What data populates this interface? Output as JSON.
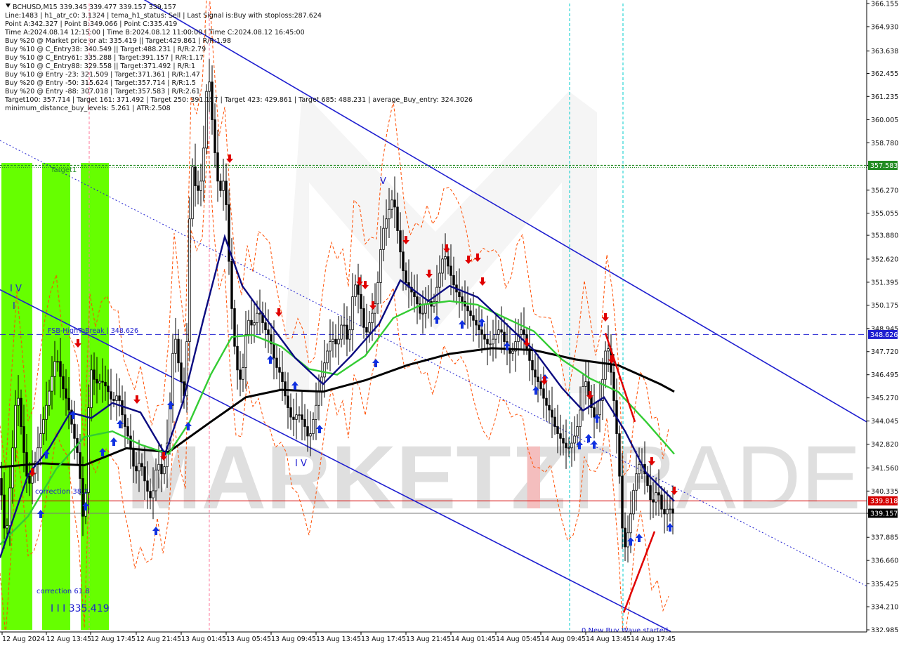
{
  "colors": {
    "background": "#ffffff",
    "green_band": "#66ff00",
    "channel_blue": "#1f1fd0",
    "candle": "#000000",
    "ma_black": "#000000",
    "ma_green": "#33cc33",
    "ma_navy": "#0a0a80",
    "envelope_orange": "#ff4d00",
    "target_line": "#228b22",
    "current_line": "#d40000",
    "bid_line": "#7a7a7a",
    "vline_cyan": "#00cccc",
    "vline_pink": "#ff7799",
    "arrow_up": "#1030e0",
    "arrow_down": "#e00000",
    "watermark": "#9a9a9a",
    "watermark_red": "#dd3333"
  },
  "info_lines": [
    "BCHUSD,M15  339.345 339.477 339.157 339.157",
    "Line:1483 | h1_atr_c0: 3.1324 | tema_h1_status: Sell | Last Signal is:Buy with stoploss:287.624",
    "Point A:342.327 | Point B:349.066 | Point C:335.419",
    "Time A:2024.08.14 12:15:00 | Time B:2024.08.12 11:00:00 | Time C:2024.08.12 16:45:00",
    "Buy %20 @ Market price or at: 335.419 || Target:429.861 | R/R:1.98",
    "Buy %10 @ C_Entry38: 340.549 || Target:488.231 | R/R:2.79",
    "Buy %10 @ C_Entry61: 335.288 | Target:391.157 | R/R:1.17",
    "Buy %10 @ C_Entry88: 329.558 || Target:371.492 | R/R:1",
    "Buy %10 @ Entry -23: 321.509 | Target:371.361 | R/R:1.47",
    "Buy %20 @ Entry -50: 315.624 | Target:357.714 | R/R:1.5",
    "Buy %20 @ Entry -88: 307.018 | Target:357.583 | R/R:2.61",
    "Target100: 357.714 | Target 161: 371.492 | Target 250: 391.157 | Target 423: 429.861 | Target 685: 488.231 | average_Buy_entry: 324.3026",
    "minimum_distance_buy_levels: 5.261 | ATR:2.508"
  ],
  "annotations": {
    "target": "Target1",
    "fsb": "FSB-HighToBreak | 348.626",
    "correction38": "correction 38.2",
    "correction61": "correction 61.8",
    "wave_iii": "I I I 335.419",
    "wave_iv": "I V",
    "wave_v": "V",
    "wave_top_left": "I V",
    "wave_top_left2": "I",
    "new_wave": "0 New Buy Wave started"
  },
  "price_tags": {
    "target": "357.583",
    "fsb": "348.626",
    "current": "339.818",
    "bid": "339.157"
  },
  "watermark": {
    "part1": "MARKETZ",
    "part2": "I",
    "part3": "TRADE"
  },
  "chart_data": {
    "type": "candlestick",
    "title": "BCHUSD,M15  339.345 339.477 339.157 339.157",
    "symbol": "BCHUSD",
    "timeframe": "M15",
    "ylim": [
      332.985,
      366.155
    ],
    "y_ticks": [
      "366.155",
      "364.930",
      "363.638",
      "362.455",
      "361.235",
      "360.005",
      "358.780",
      "357.583",
      "356.270",
      "355.055",
      "353.880",
      "352.620",
      "351.395",
      "350.175",
      "348.945",
      "347.720",
      "346.495",
      "345.270",
      "344.045",
      "342.820",
      "341.560",
      "340.335",
      "339.157",
      "337.885",
      "336.660",
      "335.425",
      "334.210",
      "332.985"
    ],
    "x_ticks": [
      "12 Aug 2024",
      "12 Aug 13:45",
      "12 Aug 17:45",
      "12 Aug 21:45",
      "13 Aug 01:45",
      "13 Aug 05:45",
      "13 Aug 09:45",
      "13 Aug 13:45",
      "13 Aug 17:45",
      "13 Aug 21:45",
      "14 Aug 01:45",
      "14 Aug 05:45",
      "14 Aug 09:45",
      "14 Aug 13:45",
      "14 Aug 17:45"
    ],
    "levels": {
      "target": 357.583,
      "fsb_high": 348.626,
      "current": 339.818,
      "bid": 339.157
    },
    "ohlc": {
      "open": 339.345,
      "high": 339.477,
      "low": 339.157,
      "close": 339.157
    },
    "close_path": [
      [
        0,
        341.0
      ],
      [
        8,
        337.5
      ],
      [
        16,
        341.5
      ],
      [
        24,
        346.0
      ],
      [
        32,
        343.0
      ],
      [
        40,
        340.5
      ],
      [
        48,
        341.5
      ],
      [
        56,
        343.0
      ],
      [
        64,
        344.5
      ],
      [
        72,
        346.0
      ],
      [
        80,
        347.6
      ],
      [
        88,
        346.0
      ],
      [
        96,
        345.0
      ],
      [
        104,
        343.5
      ],
      [
        112,
        342.0
      ],
      [
        120,
        338.0
      ],
      [
        128,
        347.0
      ],
      [
        136,
        346.0
      ],
      [
        144,
        346.2
      ],
      [
        152,
        345.8
      ],
      [
        160,
        345.0
      ],
      [
        168,
        345.5
      ],
      [
        176,
        344.0
      ],
      [
        184,
        343.0
      ],
      [
        192,
        341.2
      ],
      [
        200,
        342.0
      ],
      [
        208,
        340.5
      ],
      [
        216,
        339.8
      ],
      [
        224,
        342.0
      ],
      [
        232,
        341.0
      ],
      [
        240,
        343.5
      ],
      [
        248,
        349.0
      ],
      [
        256,
        346.5
      ],
      [
        264,
        345.0
      ],
      [
        272,
        358.0
      ],
      [
        280,
        356.0
      ],
      [
        288,
        357.0
      ],
      [
        296,
        363.0
      ],
      [
        304,
        359.0
      ],
      [
        312,
        356.0
      ],
      [
        320,
        357.0
      ],
      [
        328,
        351.0
      ],
      [
        336,
        347.0
      ],
      [
        344,
        346.0
      ],
      [
        352,
        349.5
      ],
      [
        360,
        349.0
      ],
      [
        368,
        350.0
      ],
      [
        376,
        349.0
      ],
      [
        384,
        348.5
      ],
      [
        392,
        347.0
      ],
      [
        400,
        346.5
      ],
      [
        408,
        345.0
      ],
      [
        416,
        344.0
      ],
      [
        424,
        344.5
      ],
      [
        432,
        344.0
      ],
      [
        440,
        343.0
      ],
      [
        448,
        344.5
      ],
      [
        456,
        346.0
      ],
      [
        464,
        347.5
      ],
      [
        472,
        348.5
      ],
      [
        480,
        348.0
      ],
      [
        488,
        349.5
      ],
      [
        496,
        348.0
      ],
      [
        504,
        351.5
      ],
      [
        512,
        350.5
      ],
      [
        520,
        348.5
      ],
      [
        528,
        349.5
      ],
      [
        536,
        350.5
      ],
      [
        544,
        354.0
      ],
      [
        552,
        355.0
      ],
      [
        560,
        356.0
      ],
      [
        568,
        353.5
      ],
      [
        576,
        351.5
      ],
      [
        584,
        351.0
      ],
      [
        592,
        350.5
      ],
      [
        600,
        349.5
      ],
      [
        608,
        350.5
      ],
      [
        616,
        350.0
      ],
      [
        624,
        351.5
      ],
      [
        632,
        353.0
      ],
      [
        640,
        352.0
      ],
      [
        648,
        351.0
      ],
      [
        656,
        350.5
      ],
      [
        664,
        350.0
      ],
      [
        672,
        349.5
      ],
      [
        680,
        349.0
      ],
      [
        688,
        348.5
      ],
      [
        696,
        348.0
      ],
      [
        704,
        348.5
      ],
      [
        712,
        349.0
      ],
      [
        720,
        348.0
      ],
      [
        728,
        347.5
      ],
      [
        736,
        348.5
      ],
      [
        744,
        349.0
      ],
      [
        752,
        347.5
      ],
      [
        760,
        346.5
      ],
      [
        768,
        346.0
      ],
      [
        776,
        345.0
      ],
      [
        784,
        344.5
      ],
      [
        792,
        343.5
      ],
      [
        800,
        343.0
      ],
      [
        808,
        342.5
      ],
      [
        816,
        343.0
      ],
      [
        824,
        344.0
      ],
      [
        832,
        346.5
      ],
      [
        840,
        345.0
      ],
      [
        848,
        344.0
      ],
      [
        856,
        345.5
      ],
      [
        864,
        348.5
      ],
      [
        872,
        346.0
      ],
      [
        880,
        342.5
      ],
      [
        888,
        337.0
      ],
      [
        896,
        338.5
      ],
      [
        904,
        341.0
      ],
      [
        912,
        342.0
      ],
      [
        920,
        341.0
      ],
      [
        928,
        339.5
      ],
      [
        936,
        340.5
      ],
      [
        944,
        339.0
      ],
      [
        952,
        339.5
      ],
      [
        958,
        339.157
      ]
    ],
    "series": [
      {
        "name": "",
        "color": "#000000",
        "points": [
          [
            0,
            341.6
          ],
          [
            60,
            341.8
          ],
          [
            120,
            341.7
          ],
          [
            180,
            342.6
          ],
          [
            240,
            342.4
          ],
          [
            300,
            344.0
          ],
          [
            350,
            345.3
          ],
          [
            400,
            345.7
          ],
          [
            460,
            345.6
          ],
          [
            520,
            346.2
          ],
          [
            580,
            347.0
          ],
          [
            640,
            347.6
          ],
          [
            700,
            347.9
          ],
          [
            760,
            347.8
          ],
          [
            820,
            347.3
          ],
          [
            880,
            347.0
          ],
          [
            940,
            346.0
          ],
          [
            960,
            345.6
          ]
        ]
      },
      {
        "name": "",
        "color": "#33cc33",
        "points": [
          [
            0,
            337.5
          ],
          [
            40,
            339.0
          ],
          [
            80,
            341.5
          ],
          [
            120,
            343.2
          ],
          [
            160,
            343.5
          ],
          [
            200,
            342.8
          ],
          [
            240,
            342.3
          ],
          [
            270,
            344.0
          ],
          [
            300,
            346.5
          ],
          [
            330,
            348.5
          ],
          [
            360,
            348.6
          ],
          [
            400,
            348.0
          ],
          [
            440,
            346.8
          ],
          [
            480,
            346.5
          ],
          [
            520,
            347.5
          ],
          [
            560,
            349.5
          ],
          [
            600,
            350.2
          ],
          [
            640,
            350.4
          ],
          [
            680,
            350.2
          ],
          [
            720,
            349.5
          ],
          [
            760,
            348.8
          ],
          [
            800,
            347.3
          ],
          [
            840,
            346.3
          ],
          [
            880,
            345.6
          ],
          [
            920,
            344.0
          ],
          [
            960,
            342.3
          ]
        ]
      },
      {
        "name": "",
        "color": "#0a0a80",
        "points": [
          [
            0,
            336.8
          ],
          [
            20,
            339.0
          ],
          [
            40,
            341.2
          ],
          [
            70,
            342.6
          ],
          [
            100,
            344.5
          ],
          [
            130,
            344.2
          ],
          [
            160,
            345.0
          ],
          [
            200,
            344.5
          ],
          [
            235,
            342.3
          ],
          [
            260,
            345.0
          ],
          [
            290,
            349.5
          ],
          [
            320,
            353.8
          ],
          [
            345,
            351.2
          ],
          [
            380,
            349.4
          ],
          [
            420,
            347.4
          ],
          [
            460,
            346.0
          ],
          [
            500,
            347.5
          ],
          [
            540,
            349.2
          ],
          [
            570,
            351.5
          ],
          [
            610,
            350.4
          ],
          [
            640,
            351.2
          ],
          [
            680,
            350.6
          ],
          [
            720,
            349.2
          ],
          [
            760,
            347.8
          ],
          [
            800,
            345.8
          ],
          [
            830,
            344.6
          ],
          [
            860,
            345.3
          ],
          [
            890,
            343.5
          ],
          [
            920,
            341.3
          ],
          [
            960,
            339.8
          ]
        ]
      }
    ]
  }
}
